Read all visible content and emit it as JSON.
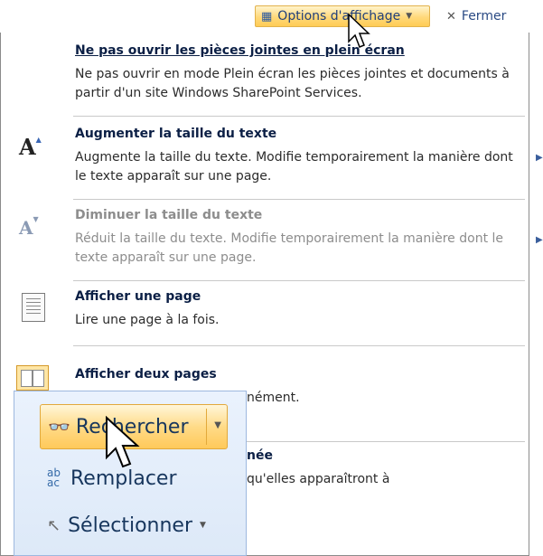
{
  "toolbar": {
    "options_label": "Options d'affichage",
    "close_label": "Fermer"
  },
  "menu": {
    "items": [
      {
        "title": "Ne pas ouvrir les pièces jointes en plein écran",
        "desc": "Ne pas ouvrir en mode Plein écran les pièces jointes et documents à partir d'un site Windows SharePoint Services."
      },
      {
        "title": "Augmenter la taille du texte",
        "desc": "Augmente la taille du texte. Modifie temporairement la manière dont le texte apparaît sur une page."
      },
      {
        "title": "Diminuer la taille du texte",
        "desc": "Réduit la taille du texte. Modifie temporairement la manière dont le texte apparaît sur une page."
      },
      {
        "title": "Afficher une page",
        "desc": "Lire une page à la fois."
      },
      {
        "title": "Afficher deux pages",
        "desc": "nément."
      },
      {
        "title": "née",
        "desc": "qu'elles apparaîtront à"
      }
    ]
  },
  "find_panel": {
    "search_label": "Rechercher",
    "replace_label": "Remplacer",
    "select_label": "Sélectionner"
  },
  "colors": {
    "highlight": "#ffd97a",
    "panel_bg": "#dde9f8",
    "text_blue": "#17365d"
  }
}
